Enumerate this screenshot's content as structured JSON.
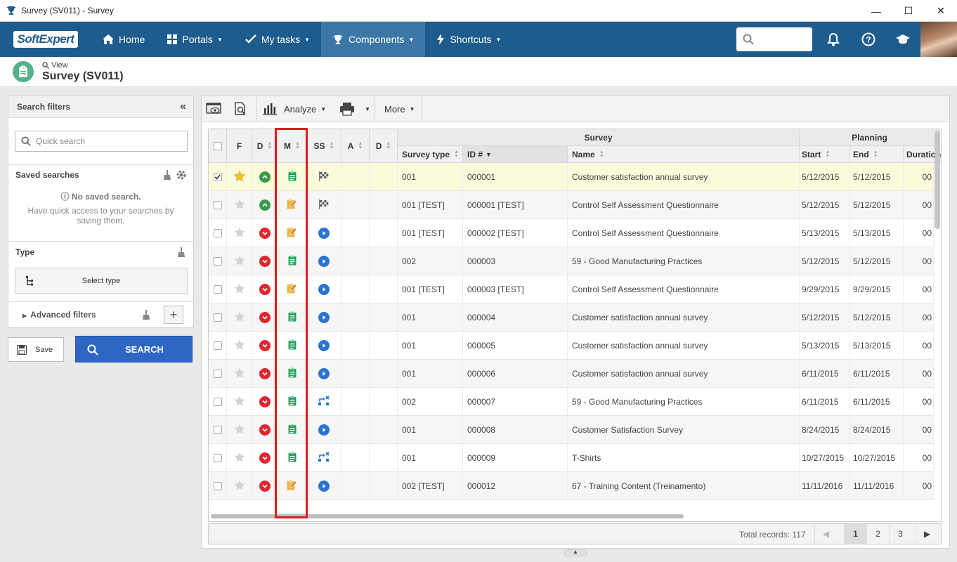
{
  "window": {
    "title": "Survey (SV011) - Survey"
  },
  "nav": {
    "brand": "SoftExpert",
    "items": [
      {
        "label": "Home",
        "icon": "home-icon"
      },
      {
        "label": "Portals",
        "icon": "grid-icon"
      },
      {
        "label": "My tasks",
        "icon": "check-icon"
      },
      {
        "label": "Components",
        "icon": "trophy-icon"
      },
      {
        "label": "Shortcuts",
        "icon": "bolt-icon"
      }
    ],
    "search_placeholder": ""
  },
  "page": {
    "view_label": "View",
    "title": "Survey (SV011)"
  },
  "filters": {
    "header": "Search filters",
    "quick_search_placeholder": "Quick search",
    "saved_searches": "Saved searches",
    "no_saved": "No saved search.",
    "no_saved_hint": "Have quick access to your searches by saving them.",
    "type_label": "Type",
    "select_type": "Select type",
    "advanced_filters": "Advanced filters",
    "save_label": "Save",
    "search_label": "SEARCH"
  },
  "toolbar": {
    "analyze": "Analyze",
    "more": "More"
  },
  "grid": {
    "columns": {
      "f": "F",
      "d": "D",
      "m": "M",
      "ss": "SS",
      "a": "A",
      "d2": "D",
      "survey_group": "Survey",
      "planning_group": "Planning",
      "survey_type": "Survey type",
      "id": "ID #",
      "name": "Name",
      "start": "Start",
      "end": "End",
      "duration": "Duration"
    },
    "rows": [
      {
        "checked": true,
        "fav": true,
        "d_status": "up",
        "m_icon": "clipboard",
        "ss_icon": "flag",
        "type": "001",
        "id": "000001",
        "name": "Customer satisfaction annual survey",
        "start": "5/12/2015",
        "end": "5/12/2015",
        "dur": "00"
      },
      {
        "checked": false,
        "fav": false,
        "d_status": "up",
        "m_icon": "edit",
        "ss_icon": "flag",
        "type": "001 [TEST]",
        "id": "000001 [TEST]",
        "name": "Control Self Assessment Questionnaire",
        "start": "5/12/2015",
        "end": "5/12/2015",
        "dur": "00"
      },
      {
        "checked": false,
        "fav": false,
        "d_status": "down",
        "m_icon": "edit",
        "ss_icon": "play",
        "type": "001 [TEST]",
        "id": "000002 [TEST]",
        "name": "Control Self Assessment Questionnaire",
        "start": "5/13/2015",
        "end": "5/13/2015",
        "dur": "00"
      },
      {
        "checked": false,
        "fav": false,
        "d_status": "down",
        "m_icon": "clipboard",
        "ss_icon": "play",
        "type": "002",
        "id": "000003",
        "name": "59 - Good Manufacturing Practices",
        "start": "5/12/2015",
        "end": "5/12/2015",
        "dur": "00"
      },
      {
        "checked": false,
        "fav": false,
        "d_status": "down",
        "m_icon": "edit",
        "ss_icon": "play",
        "type": "001 [TEST]",
        "id": "000003 [TEST]",
        "name": "Control Self Assessment Questionnaire",
        "start": "9/29/2015",
        "end": "9/29/2015",
        "dur": "00"
      },
      {
        "checked": false,
        "fav": false,
        "d_status": "down",
        "m_icon": "clipboard",
        "ss_icon": "play",
        "type": "001",
        "id": "000004",
        "name": "Customer satisfaction annual survey",
        "start": "5/12/2015",
        "end": "5/12/2015",
        "dur": "00"
      },
      {
        "checked": false,
        "fav": false,
        "d_status": "down",
        "m_icon": "clipboard",
        "ss_icon": "play",
        "type": "001",
        "id": "000005",
        "name": "Customer satisfaction annual survey",
        "start": "5/13/2015",
        "end": "5/13/2015",
        "dur": "00"
      },
      {
        "checked": false,
        "fav": false,
        "d_status": "down",
        "m_icon": "clipboard",
        "ss_icon": "play",
        "type": "001",
        "id": "000006",
        "name": "Customer satisfaction annual survey",
        "start": "6/11/2015",
        "end": "6/11/2015",
        "dur": "00"
      },
      {
        "checked": false,
        "fav": false,
        "d_status": "down",
        "m_icon": "clipboard",
        "ss_icon": "flow",
        "type": "002",
        "id": "000007",
        "name": "59 - Good Manufacturing Practices",
        "start": "6/11/2015",
        "end": "6/11/2015",
        "dur": "00"
      },
      {
        "checked": false,
        "fav": false,
        "d_status": "down",
        "m_icon": "clipboard",
        "ss_icon": "play",
        "type": "001",
        "id": "000008",
        "name": "Customer Satisfaction Survey",
        "start": "8/24/2015",
        "end": "8/24/2015",
        "dur": "00"
      },
      {
        "checked": false,
        "fav": false,
        "d_status": "down",
        "m_icon": "clipboard",
        "ss_icon": "flow",
        "type": "001",
        "id": "000009",
        "name": "T-Shirts",
        "start": "10/27/2015",
        "end": "10/27/2015",
        "dur": "00"
      },
      {
        "checked": false,
        "fav": false,
        "d_status": "down",
        "m_icon": "edit",
        "ss_icon": "play",
        "type": "002 [TEST]",
        "id": "000012",
        "name": "67 - Training Content (Treinamento)",
        "start": "11/11/2016",
        "end": "11/11/2016",
        "dur": "00"
      }
    ],
    "total_label": "Total records: 117",
    "pages": [
      "1",
      "2",
      "3"
    ],
    "current_page": "1"
  },
  "colors": {
    "nav": "#1e5c8e",
    "nav_active": "#3d77a8",
    "selected_row": "#fbfbdc",
    "highlight_box": "#e11b1b",
    "search_btn": "#2f66c4"
  }
}
